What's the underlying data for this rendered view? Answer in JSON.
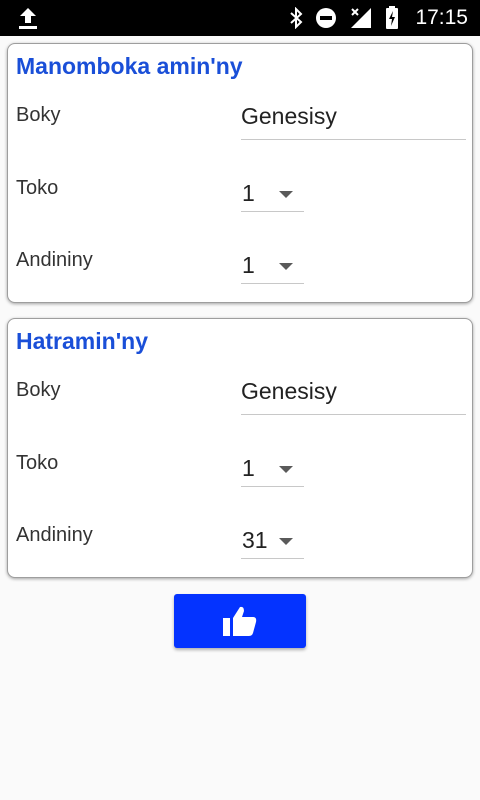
{
  "status_bar": {
    "time": "17:15",
    "icons": [
      "upload-icon",
      "bluetooth-icon",
      "do-not-disturb-icon",
      "no-signal-icon",
      "battery-charging-icon"
    ]
  },
  "start": {
    "title": "Manomboka amin'ny",
    "book_label": "Boky",
    "book_value": "Genesisy",
    "chapter_label": "Toko",
    "chapter_value": "1",
    "verse_label": "Andininy",
    "verse_value": "1"
  },
  "end": {
    "title": "Hatramin'ny",
    "book_label": "Boky",
    "book_value": "Genesisy",
    "chapter_label": "Toko",
    "chapter_value": "1",
    "verse_label": "Andininy",
    "verse_value": "31"
  },
  "confirm": {
    "icon": "thumbs-up-icon"
  },
  "colors": {
    "accent": "#0433ff",
    "title": "#1a4fd8",
    "status_bar": "#000000"
  }
}
